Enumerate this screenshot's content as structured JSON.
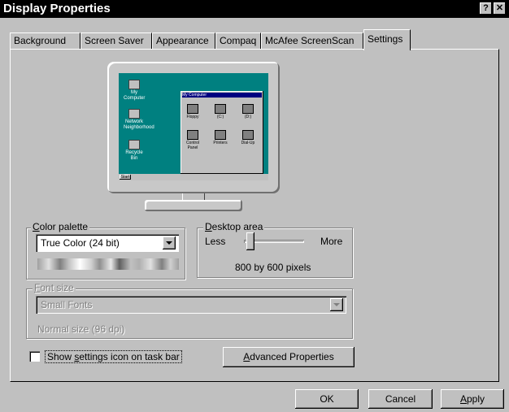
{
  "window": {
    "title": "Display Properties",
    "help_glyph": "?",
    "close_glyph": "✕"
  },
  "tabs": [
    {
      "label": "Background"
    },
    {
      "label": "Screen Saver"
    },
    {
      "label": "Appearance"
    },
    {
      "label": "Compaq"
    },
    {
      "label": "McAfee ScreenScan"
    },
    {
      "label": "Settings"
    }
  ],
  "preview": {
    "desktop_icons": [
      "My Computer",
      "Network Neighborhood",
      "Recycle Bin"
    ],
    "window_title": "My Computer",
    "window_items": [
      "Floppy",
      "(C:)",
      "(D:)",
      "Control Panel",
      "Printers",
      "Dial-Up"
    ],
    "taskbar_start": "Start"
  },
  "color_palette": {
    "legend": "Color palette",
    "legend_accel": "C",
    "selected": "True Color (24 bit)"
  },
  "desktop_area": {
    "legend": "Desktop area",
    "legend_accel": "D",
    "less_label": "Less",
    "more_label": "More",
    "value_text": "800 by 600 pixels",
    "slider_value": 0.05
  },
  "font_size": {
    "legend": "Font size",
    "legend_accel": "F",
    "selected": "Small Fonts",
    "note": "Normal size (96 dpi)"
  },
  "show_icon_checkbox": {
    "label": "Show settings icon on task bar",
    "checked": false
  },
  "advanced_button": {
    "label": "Advanced Properties"
  },
  "buttons": {
    "ok": "OK",
    "cancel": "Cancel",
    "apply": "Apply"
  },
  "colors": {
    "desktop": "#008080",
    "face": "#c0c0c0",
    "title_bar": "#000000"
  }
}
